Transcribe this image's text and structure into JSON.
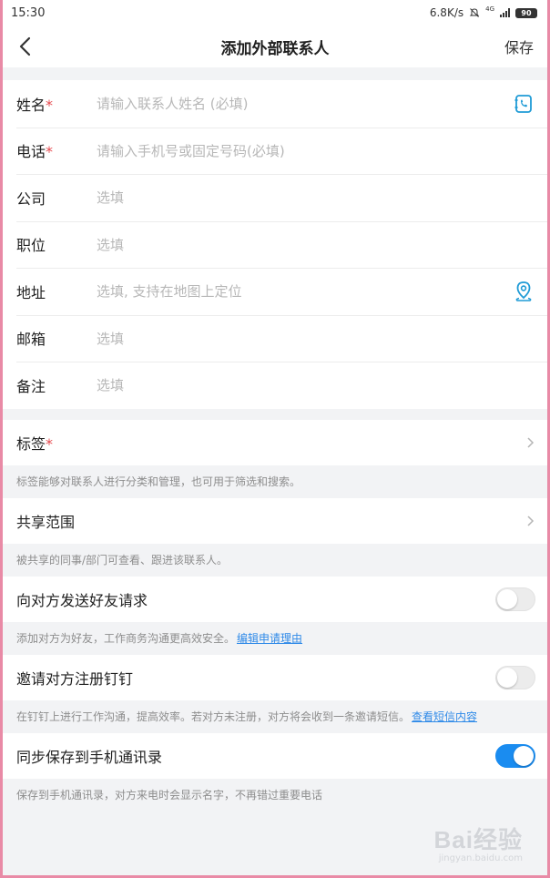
{
  "status_bar": {
    "time": "15:30",
    "speed": "6.8K/s",
    "network": "4G",
    "battery": "90"
  },
  "header": {
    "title": "添加外部联系人",
    "save_label": "保存"
  },
  "form": {
    "name_label": "姓名",
    "name_placeholder": "请输入联系人姓名 (必填)",
    "phone_label": "电话",
    "phone_placeholder": "请输入手机号或固定号码(必填)",
    "company_label": "公司",
    "company_placeholder": "选填",
    "position_label": "职位",
    "position_placeholder": "选填",
    "address_label": "地址",
    "address_placeholder": "选填, 支持在地图上定位",
    "email_label": "邮箱",
    "email_placeholder": "选填",
    "remark_label": "备注",
    "remark_placeholder": "选填",
    "required_mark": "*"
  },
  "tags": {
    "label": "标签",
    "hint": "标签能够对联系人进行分类和管理，也可用于筛选和搜索。"
  },
  "share": {
    "label": "共享范围",
    "hint": "被共享的同事/部门可查看、跟进该联系人。"
  },
  "friend_request": {
    "label": "向对方发送好友请求",
    "enabled": false,
    "hint": "添加对方为好友，工作商务沟通更高效安全。",
    "link": "编辑申请理由"
  },
  "invite": {
    "label": "邀请对方注册钉钉",
    "enabled": false,
    "hint": "在钉钉上进行工作沟通，提高效率。若对方未注册，对方将会收到一条邀请短信。",
    "link": "查看短信内容"
  },
  "sync": {
    "label": "同步保存到手机通讯录",
    "enabled": true,
    "hint": "保存到手机通讯录，对方来电时会显示名字，不再错过重要电话"
  },
  "watermark": {
    "logo": "Bai经验",
    "url": "jingyan.baidu.com"
  },
  "colors": {
    "accent": "#1a8cf0",
    "required": "#e5484d",
    "link": "#2f8ae8",
    "icon": "#1f9bd6"
  }
}
